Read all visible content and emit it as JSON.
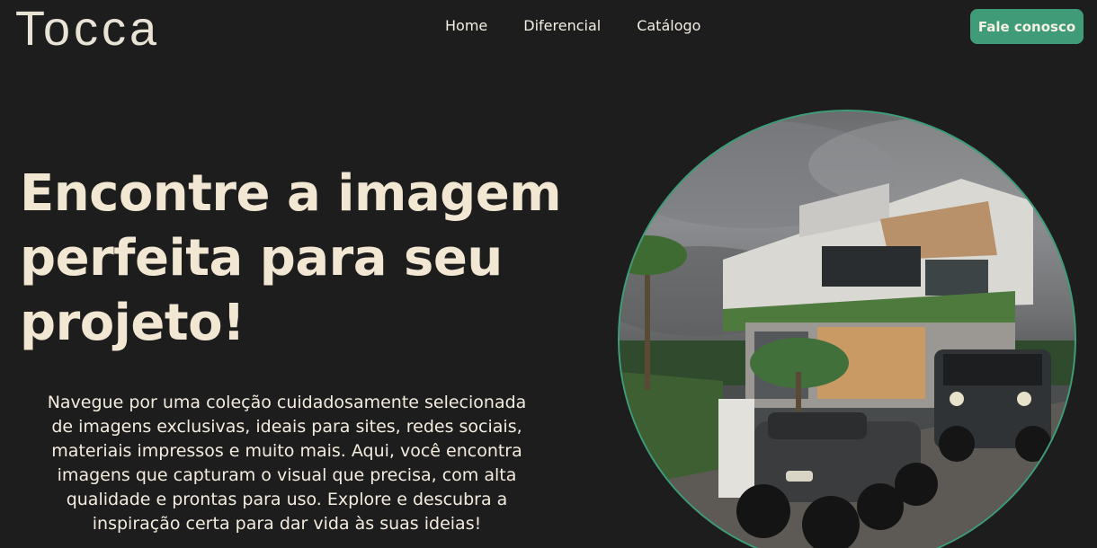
{
  "brand": {
    "logo": "Tocca"
  },
  "nav": {
    "items": [
      {
        "label": "Home"
      },
      {
        "label": "Diferencial"
      },
      {
        "label": "Catálogo"
      }
    ],
    "cta_label": "Fale conosco"
  },
  "hero": {
    "headline_lines": [
      "Encontre a imagem",
      "perfeita para seu",
      "projeto!"
    ],
    "description_lines": [
      "Navegue por uma coleção cuidadosamente selecionada",
      "de imagens exclusivas, ideais para sites, redes sociais,",
      "materiais impressos e muito mais. Aqui, você encontra",
      "imagens que capturam o visual que precisa, com alta",
      "qualidade e prontas para uso. Explore e descubra a",
      "inspiração certa para dar vida às suas ideias!"
    ],
    "image_alt": "Modern house with vehicles"
  },
  "colors": {
    "background": "#1e1d1d",
    "accent": "#3f9b78",
    "text": "#f1e7d2"
  }
}
